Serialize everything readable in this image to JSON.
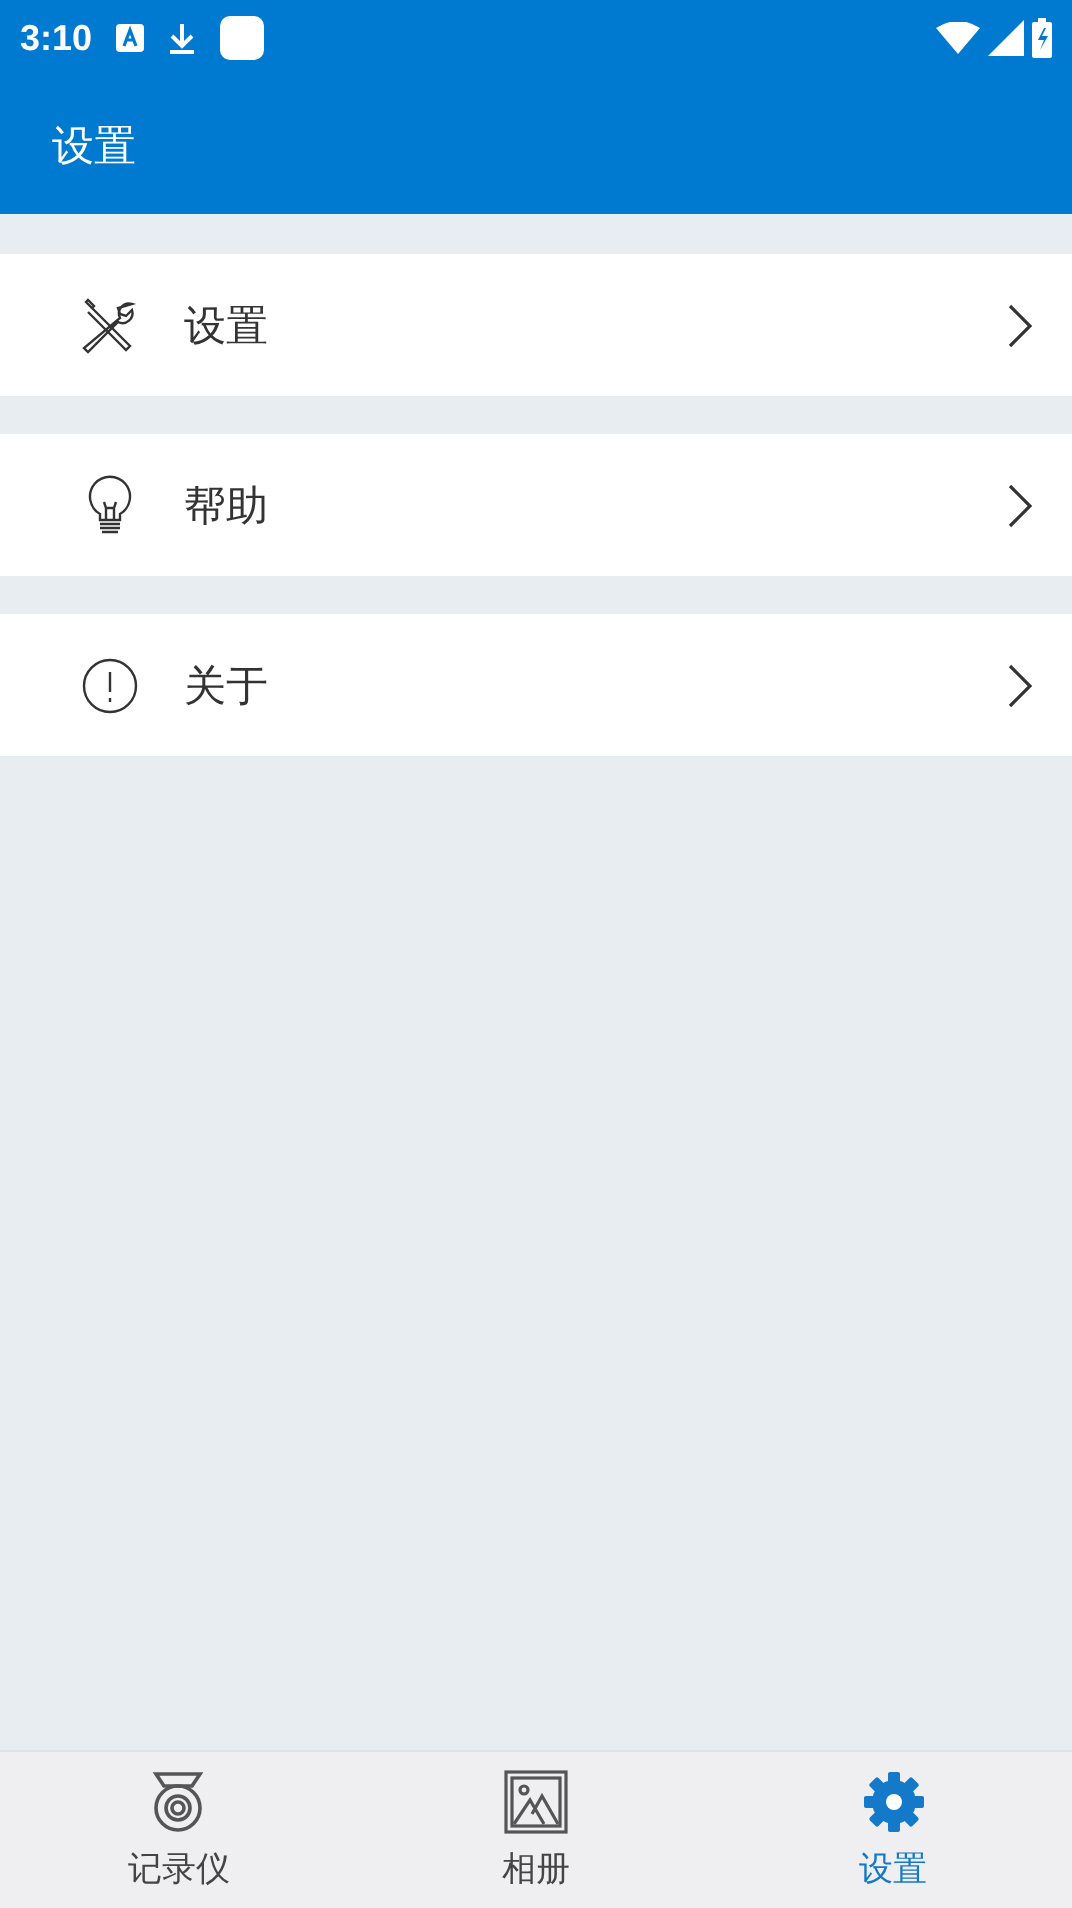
{
  "status_bar": {
    "time": "3:10"
  },
  "app_bar": {
    "title": "设置"
  },
  "menu": [
    {
      "kind": "tools",
      "label": "设置"
    },
    {
      "kind": "bulb",
      "label": "帮助"
    },
    {
      "kind": "info",
      "label": "关于"
    }
  ],
  "bottom_nav": [
    {
      "kind": "recorder",
      "label": "记录仪",
      "selected": false
    },
    {
      "kind": "album",
      "label": "相册",
      "selected": false
    },
    {
      "kind": "settings",
      "label": "设置",
      "selected": true
    }
  ]
}
